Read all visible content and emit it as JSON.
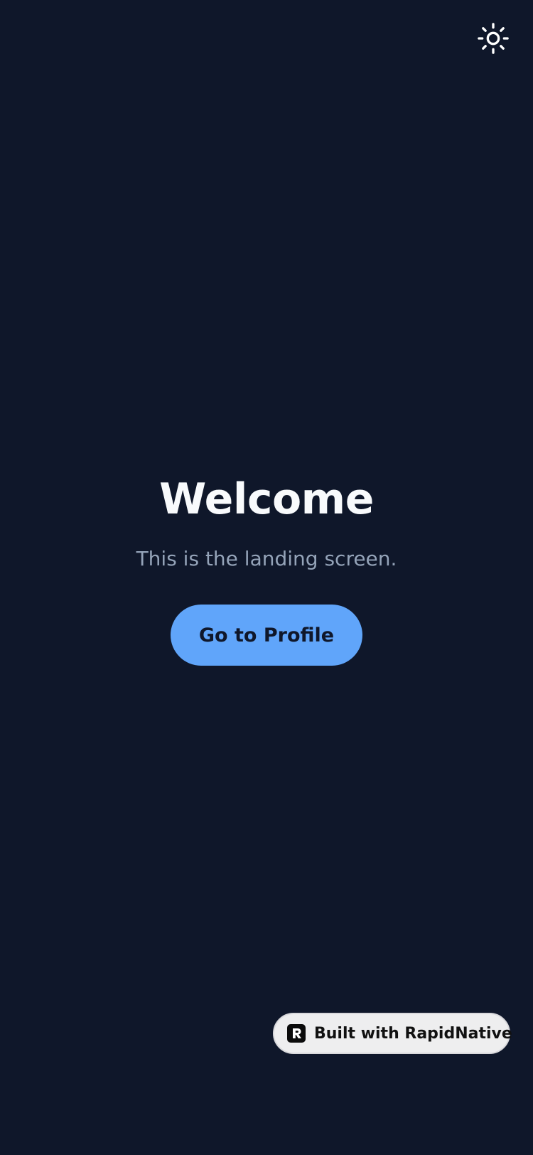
{
  "theme_toggle": {
    "icon": "sun-icon",
    "color": "#ffffff"
  },
  "main": {
    "title": "Welcome",
    "subtitle": "This is the landing screen.",
    "primary_button_label": "Go to Profile"
  },
  "badge": {
    "icon": "rapidnative-logo-icon",
    "label": "Built with RapidNative"
  },
  "colors": {
    "background": "#0f172a",
    "title": "#f8fafc",
    "subtitle": "#94a3b8",
    "accent": "#60a5fa",
    "button_text": "#0f172a",
    "badge_background": "#eeeeef"
  }
}
